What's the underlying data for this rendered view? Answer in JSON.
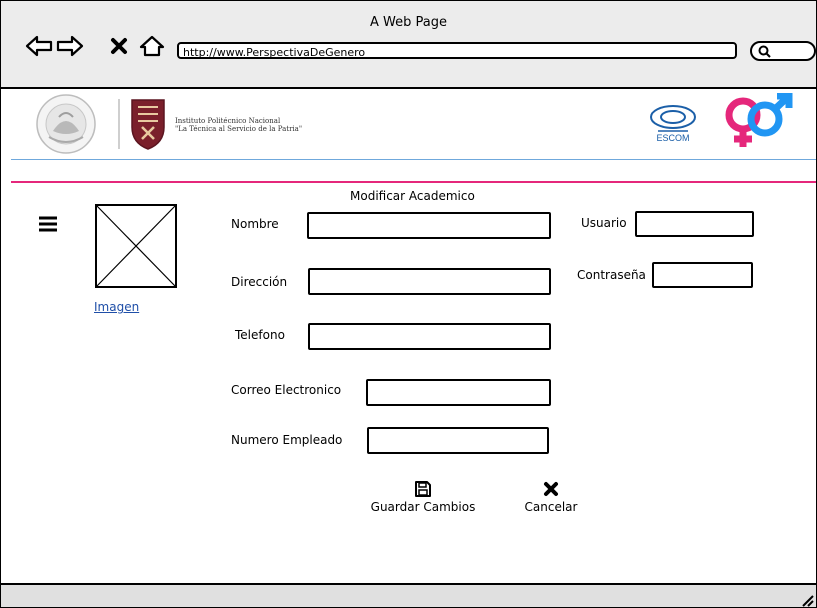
{
  "window": {
    "title": "A Web Page"
  },
  "browser": {
    "url": "http://www.PerspectivaDeGenero",
    "icons": [
      "back-arrow-icon",
      "forward-arrow-icon",
      "close-x-icon",
      "home-icon",
      "search-icon"
    ]
  },
  "header": {
    "institution_line1": "Instituto Politécnico Nacional",
    "institution_line2": "\"La Técnica al Servicio de la Patria\"",
    "escom_label": "ESCOM",
    "colors": {
      "blue_line": "#6fa8dc",
      "pink_line": "#e5277b",
      "gender_pink": "#e5277b",
      "gender_blue": "#2196f3"
    }
  },
  "form": {
    "title": "Modificar Academico",
    "image_link": "Imagen",
    "fields": {
      "nombre": {
        "label": "Nombre",
        "value": ""
      },
      "direccion": {
        "label": "Dirección",
        "value": ""
      },
      "telefono": {
        "label": "Telefono",
        "value": ""
      },
      "correo": {
        "label": "Correo Electronico",
        "value": ""
      },
      "numero_empleado": {
        "label": "Numero Empleado",
        "value": ""
      },
      "usuario": {
        "label": "Usuario",
        "value": ""
      },
      "contrasena": {
        "label": "Contraseña",
        "value": ""
      }
    },
    "actions": {
      "save": {
        "label": "Guardar Cambios",
        "icon": "floppy-disk-icon"
      },
      "cancel": {
        "label": "Cancelar",
        "icon": "x-icon"
      }
    }
  }
}
